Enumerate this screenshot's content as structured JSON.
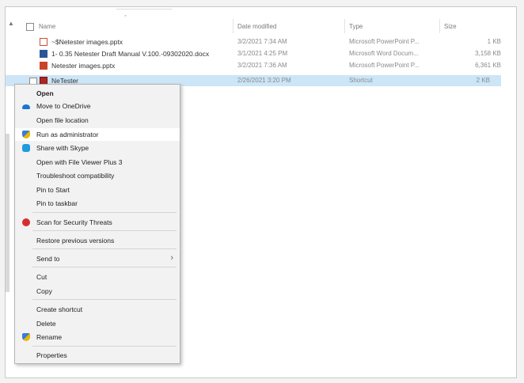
{
  "header": {
    "name_label": "Name",
    "date_label": "Date modified",
    "type_label": "Type",
    "size_label": "Size"
  },
  "files": [
    {
      "name": "~$Netester images.pptx",
      "date": "3/2/2021 7:34 AM",
      "type": "Microsoft PowerPoint P...",
      "size": "1 KB",
      "icon": "powerpoint-temp-icon"
    },
    {
      "name": "1- 0.35 Netester Draft  Manual V.100.-09302020.docx",
      "date": "3/1/2021 4:25 PM",
      "type": "Microsoft Word Docum...",
      "size": "3,158 KB",
      "icon": "word-document-icon"
    },
    {
      "name": "Netester images.pptx",
      "date": "3/2/2021 7:36 AM",
      "type": "Microsoft PowerPoint P...",
      "size": "6,361 KB",
      "icon": "powerpoint-icon"
    },
    {
      "name": "NeTester",
      "date": "2/26/2021 3:20 PM",
      "type": "Shortcut",
      "size": "2 KB",
      "icon": "shortcut-icon"
    }
  ],
  "context_menu": {
    "items": [
      {
        "label": "Open",
        "icon": ""
      },
      {
        "label": "Move to OneDrive",
        "icon": "onedrive-cloud-icon"
      },
      {
        "label": "Open file location",
        "icon": ""
      },
      {
        "label": "Run as administrator",
        "icon": "admin-shield-icon"
      },
      {
        "label": "Share with Skype",
        "icon": "skype-icon"
      },
      {
        "label": "Open with File Viewer Plus 3",
        "icon": ""
      },
      {
        "label": "Troubleshoot compatibility",
        "icon": ""
      },
      {
        "label": "Pin to Start",
        "icon": ""
      },
      {
        "label": "Pin to taskbar",
        "icon": ""
      },
      {
        "label": "Scan for Security Threats",
        "icon": "security-scan-icon"
      },
      {
        "label": "Restore previous versions",
        "icon": ""
      },
      {
        "label": "Send to",
        "icon": "chevron-right-icon"
      },
      {
        "label": "Cut",
        "icon": ""
      },
      {
        "label": "Copy",
        "icon": ""
      },
      {
        "label": "Create shortcut",
        "icon": ""
      },
      {
        "label": "Delete",
        "icon": ""
      },
      {
        "label": "Rename",
        "icon": "rename-shield-icon"
      },
      {
        "label": "Properties",
        "icon": ""
      }
    ],
    "chevron_glyph": "›"
  },
  "colors": {
    "selection": "#cce5f7",
    "menu_background": "#f2f2f2",
    "hover": "#ffffff"
  }
}
